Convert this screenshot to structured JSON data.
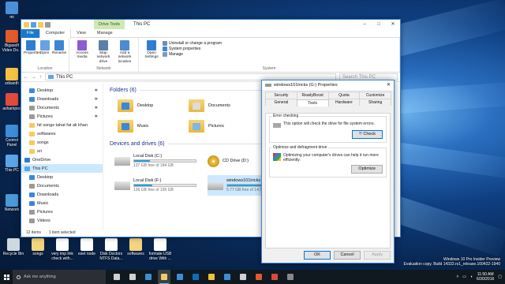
{
  "desktop": {
    "left_icons": [
      {
        "label": "mi",
        "color": "#4a8fd8"
      },
      {
        "label": "Bigasoft Video Do...",
        "color": "#e35b2b"
      },
      {
        "label": "srikanth",
        "color": "#f4c242"
      },
      {
        "label": "ashampoo",
        "color": "#e14b3c"
      },
      {
        "label": "Control Panel",
        "color": "#3b8ed8"
      },
      {
        "label": "This PC",
        "color": "#5aa6e8"
      },
      {
        "label": "Network",
        "color": "#4a9ad8"
      }
    ],
    "bottom_icons": [
      {
        "label": "Recycle Bin",
        "color": "#cfd8e0"
      },
      {
        "label": "songs",
        "color": "#f3d57e"
      },
      {
        "label": "very imp link check with...",
        "color": "#ffffff"
      },
      {
        "label": "eset node",
        "color": "#ffffff"
      },
      {
        "label": "Disk Doctors NTFS Data...",
        "color": "#ffffff"
      },
      {
        "label": "softwares",
        "color": "#f3d57e"
      },
      {
        "label": "formate USB drive With ...",
        "color": "#ffffff"
      }
    ],
    "watermark": {
      "line1": "Windows 10 Pro Insider Preview",
      "line2": "Evaluation copy. Build 14332.rs1_release.160422-1940"
    }
  },
  "explorer": {
    "context_tab": "Drive Tools",
    "title": "This PC",
    "tabs": [
      "File",
      "Computer",
      "View",
      "Manage"
    ],
    "ribbon": {
      "location": {
        "label": "Location",
        "buttons": [
          {
            "label": "Properties",
            "icon": "properties-icon",
            "color": "#2f7dd1"
          },
          {
            "label": "Open",
            "icon": "open-icon",
            "color": "#6aa1e0"
          },
          {
            "label": "Rename",
            "icon": "rename-icon",
            "color": "#3c86d4"
          }
        ]
      },
      "network": {
        "label": "Network",
        "buttons": [
          {
            "label": "Access media",
            "icon": "media-icon",
            "color": "#8f5bd3"
          },
          {
            "label": "Map network drive",
            "icon": "network-drive-icon",
            "color": "#5b7fa7"
          },
          {
            "label": "Add a network location",
            "icon": "network-location-icon",
            "color": "#4c8bd1"
          }
        ]
      },
      "system": {
        "label": "System",
        "open_settings": "Open Settings",
        "items": [
          "Uninstall or change a program",
          "System properties",
          "Manage"
        ]
      }
    },
    "address": {
      "path": "This PC",
      "search_placeholder": "Search This PC"
    },
    "nav": [
      {
        "label": "Desktop",
        "pinned": true,
        "color": "#3b88d8"
      },
      {
        "label": "Downloads",
        "pinned": true,
        "color": "#3b88d8"
      },
      {
        "label": "Documents",
        "pinned": true,
        "color": "#9a9a9a"
      },
      {
        "label": "Pictures",
        "pinned": true,
        "color": "#9a9a9a"
      },
      {
        "label": "hit songs tahat fat ali khan",
        "pinned": false,
        "color": "#f3cc5c"
      },
      {
        "label": "softwares",
        "pinned": false,
        "color": "#f3cc5c"
      },
      {
        "label": "songs",
        "pinned": false,
        "color": "#f3cc5c"
      },
      {
        "label": "sri",
        "pinned": false,
        "color": "#f3cc5c"
      },
      {
        "label": "OneDrive",
        "pinned": false,
        "color": "#2f7dd1"
      },
      {
        "label": "This PC",
        "pinned": false,
        "color": "#5aa6e8",
        "selected": true
      },
      {
        "label": "Desktop",
        "pinned": false,
        "color": "#3b88d8"
      },
      {
        "label": "Documents",
        "pinned": false,
        "color": "#9a9a9a"
      },
      {
        "label": "Downloads",
        "pinned": false,
        "color": "#3b88d8"
      },
      {
        "label": "Music",
        "pinned": false,
        "color": "#3b88d8"
      },
      {
        "label": "Pictures",
        "pinned": false,
        "color": "#9a9a9a"
      },
      {
        "label": "Videos",
        "pinned": false,
        "color": "#9a9a9a"
      }
    ],
    "folders_header": "Folders (6)",
    "folders": [
      {
        "label": "Desktop",
        "badge": "#3b88d8"
      },
      {
        "label": "Documents",
        "badge": "#dcdcdc"
      },
      {
        "label": "Music",
        "badge": "#3b88d8"
      },
      {
        "label": "Pictures",
        "badge": "#7fb6e6"
      }
    ],
    "drives_header": "Devices and drives (6)",
    "drives": [
      {
        "name": "Local Disk (C:)",
        "detail": "137 GB free of 184 GB",
        "used": 0.26,
        "type": "hdd"
      },
      {
        "name": "CD Drive (D:)",
        "detail": "",
        "used": 0,
        "type": "cd"
      },
      {
        "name": "Local Disk (F:)",
        "detail": "136 GB free of 195 GB",
        "used": 0.3,
        "type": "hdd"
      },
      {
        "name": "windows101tricks (G:)",
        "detail": "5.77 GB free of 14.5 GB",
        "used": 0.6,
        "type": "usb",
        "selected": true
      }
    ],
    "status": {
      "items": "12 items",
      "selected": "1 item selected"
    }
  },
  "dialog": {
    "title": "windows101tricks (G:) Properties",
    "tabs_row1": [
      "Security",
      "ReadyBoost",
      "Quota",
      "Customize"
    ],
    "tabs_row2": [
      "General",
      "Tools",
      "Hardware",
      "Sharing"
    ],
    "active_tab": "Tools",
    "error_checking": {
      "title": "Error checking",
      "text": "This option will check the drive for file system errors.",
      "button": "Check"
    },
    "optimize": {
      "title": "Optimize and defragment drive",
      "text": "Optimizing your computer's drives can help it run more efficiently.",
      "button": "Optimize"
    },
    "buttons": {
      "ok": "OK",
      "cancel": "Cancel",
      "apply": "Apply"
    }
  },
  "taskbar": {
    "search_placeholder": "Ask me anything",
    "apps": [
      {
        "icon": "mic-icon",
        "color": "#cfcfcf"
      },
      {
        "icon": "task-view-icon",
        "color": "#cfcfcf"
      },
      {
        "icon": "edge-icon",
        "color": "#3b8ed8"
      },
      {
        "icon": "file-explorer-icon",
        "color": "#f3cc5c",
        "active": true
      },
      {
        "icon": "store-icon",
        "color": "#3b8ed8"
      },
      {
        "icon": "outlook-icon",
        "color": "#0f6cbd"
      },
      {
        "icon": "chrome-icon",
        "color": "#e8c23a"
      },
      {
        "icon": "mail-icon",
        "color": "#3b8ed8"
      },
      {
        "icon": "settings-icon",
        "color": "#cfcfcf"
      },
      {
        "icon": "media-icon",
        "color": "#e35b2b"
      },
      {
        "icon": "recorder-icon",
        "color": "#d94a3a"
      },
      {
        "icon": "app-icon",
        "color": "#888888"
      }
    ],
    "clock": {
      "time": "11:50 AM",
      "date": "6/30/2016"
    }
  }
}
